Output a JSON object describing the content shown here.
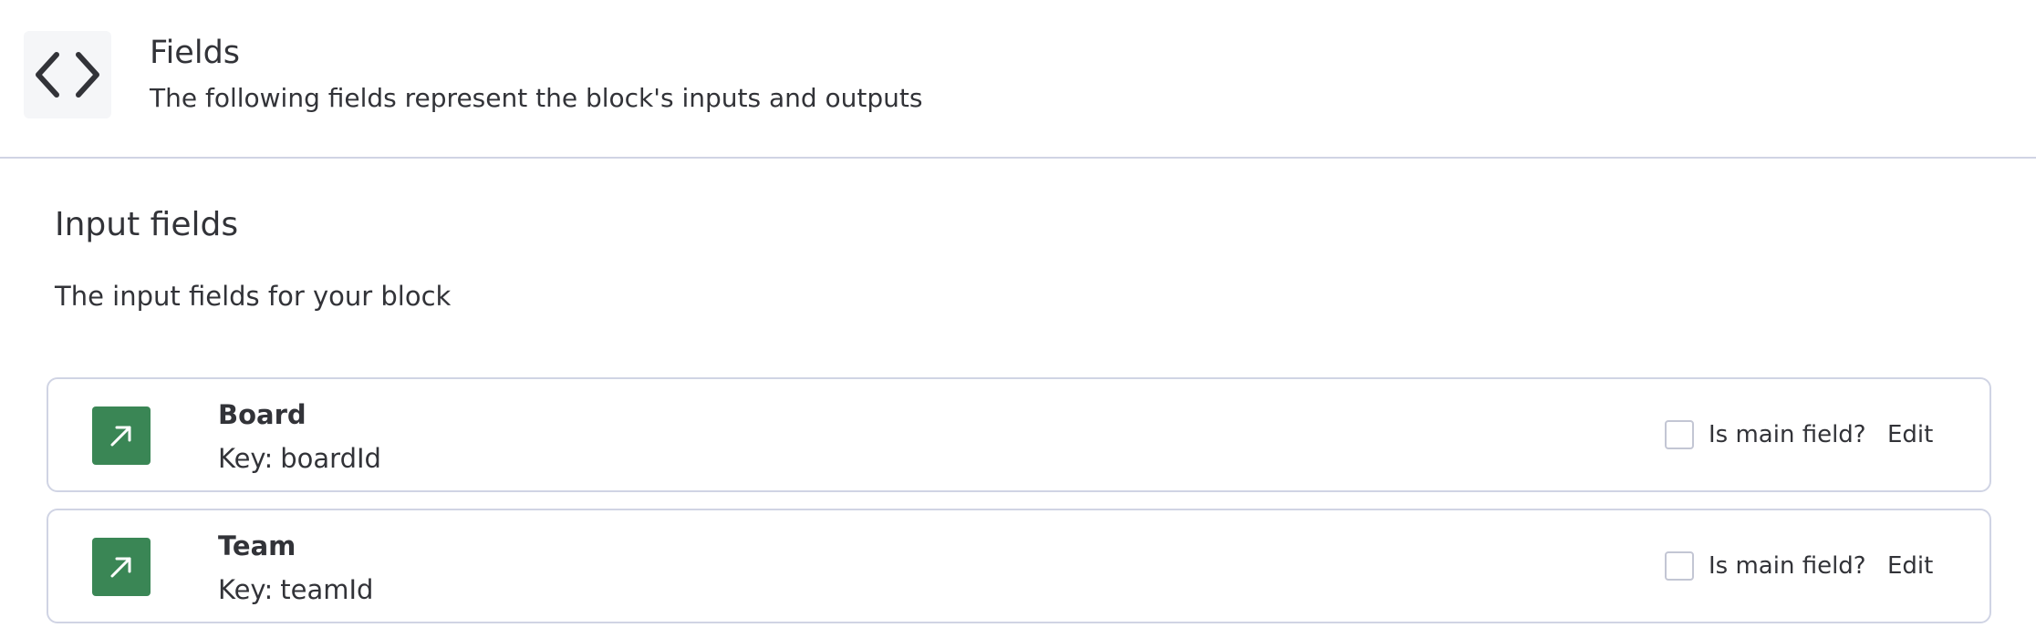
{
  "header": {
    "icon": "code-brackets-icon",
    "title": "Fields",
    "subtitle": "The following fields represent the block's inputs and outputs"
  },
  "input_section": {
    "title": "Input fields",
    "description": "The input fields for your block"
  },
  "fields": [
    {
      "name": "Board",
      "key_label": "Key:",
      "key": "boardId",
      "icon": "arrow-up-right-icon",
      "main_label": "Is main field?",
      "main_checked": false,
      "edit_label": "Edit"
    },
    {
      "name": "Team",
      "key_label": "Key:",
      "key": "teamId",
      "icon": "arrow-up-right-icon",
      "main_label": "Is main field?",
      "main_checked": false,
      "edit_label": "Edit"
    }
  ],
  "colors": {
    "field_icon_bg": "#3a8655",
    "divider": "#d0d4e4",
    "text": "#323338",
    "header_icon_bg": "#f5f6f8"
  }
}
